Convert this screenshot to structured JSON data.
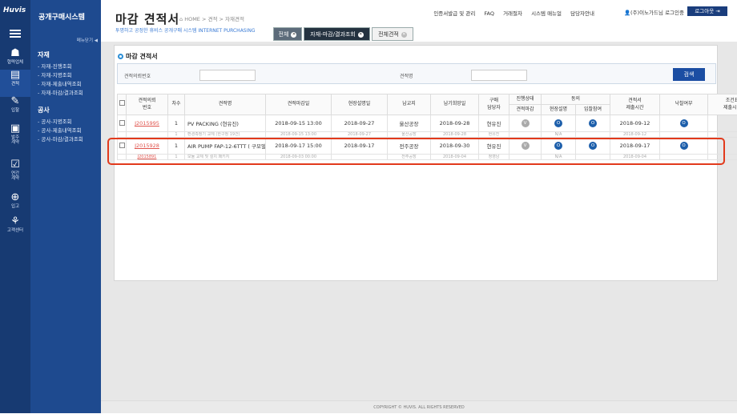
{
  "brand": {
    "logo": "Huvis",
    "system_title": "공개구매시스템"
  },
  "icon_nav": [
    {
      "label": "협력업체",
      "icon": "building-icon"
    },
    {
      "label": "견적",
      "icon": "clipboard-icon"
    },
    {
      "label": "입찰",
      "icon": "gavel-icon"
    },
    {
      "label": "발주\n계약",
      "icon": "document-icon"
    },
    {
      "label": "연간\n계약",
      "icon": "calendar-icon"
    },
    {
      "label": "입고",
      "icon": "globe-icon"
    },
    {
      "label": "고객센터",
      "icon": "plant-icon"
    }
  ],
  "sidebar": {
    "fold_label": "메뉴닫기 ◀",
    "sections": [
      {
        "title": "자재",
        "items": [
          "- 자재-진행조회",
          "- 자재-지명조회",
          "- 자재-제출내역조회",
          "- 자재-마감/결과조회"
        ]
      },
      {
        "title": "공사",
        "items": [
          "- 공사-지명조회",
          "- 공사-제출내역조회",
          "- 공사-마감/결과조회"
        ]
      }
    ]
  },
  "header": {
    "title": "마감 견적서",
    "breadcrumb": "⌂ HOME > 견적 > 자재견적",
    "subtitle": "투명하고 공정한 휴비스 공개구매 시스템 INTERNET PURCHASING",
    "links": [
      "인증서발급 및 관리",
      "FAQ",
      "거래절차",
      "시스템 매뉴얼",
      "담당자안내"
    ],
    "user": "(주)이노가드님 로그인중",
    "logout_label": "로그아웃 ⇥"
  },
  "tabs": [
    {
      "label": "전체",
      "style": "medium"
    },
    {
      "label": "자재-마감/결과조회",
      "style": "dark"
    },
    {
      "label": "전체견적",
      "style": "light"
    }
  ],
  "panel": {
    "title": "마감 견적서",
    "search": {
      "label1": "견적의뢰번호",
      "value1": "",
      "label2": "견적명",
      "value2": "",
      "button": "검색"
    }
  },
  "table": {
    "headers": {
      "no": "견적의뢰\n번호",
      "cnt": "차수",
      "name": "견적명",
      "deadline": "견적마감일",
      "site": "현장설명일",
      "place": "납교지",
      "delivery": "납기희망일",
      "owner": "구매\n담당자",
      "status": "진행상태",
      "status_sub": "견적마감",
      "agree": "동의",
      "agree1": "현장설명",
      "agree2": "입찰참여",
      "submit": "견적서\n제출시간",
      "award": "낙찰여부",
      "cond": "조건표\n제출시간"
    },
    "rows": [
      {
        "no": "J2015995",
        "cnt": "1",
        "name": "PV PACKING (현유진)",
        "deadline": "2018-09-15 13:00",
        "site": "2018-09-27",
        "place": "울산공장",
        "delivery": "2018-09-28",
        "owner": "현유진",
        "status": "V",
        "agree1": "O",
        "agree2": "O",
        "submit": "2018-09-12",
        "award": "O",
        "cond": ""
      },
      {
        "no": "",
        "cnt": "1",
        "name": "환경측정기 교체 (한구정 19건)",
        "deadline": "2018-09-15 13:00",
        "site": "2018-09-27",
        "place": "울산공장",
        "delivery": "2018-09-28",
        "owner": "현유진",
        "status": "",
        "agree1": "N/A",
        "agree2": "",
        "submit": "2018-09-12",
        "award": "",
        "cond": ""
      },
      {
        "no": "J2015928",
        "cnt": "1",
        "name": "AIR PUMP  FAP-12-6TTT ( 구모델/",
        "deadline": "2018-09-17 15:00",
        "site": "2018-09-17",
        "place": "전주공장",
        "delivery": "2018-09-30",
        "owner": "현유진",
        "status": "V",
        "agree1": "O",
        "agree2": "O",
        "submit": "2018-09-17",
        "award": "O",
        "cond": ""
      },
      {
        "no": "J2015891",
        "cnt": "1",
        "name": "모듈 교체 및 설치 패키지",
        "deadline": "2018-09-03 00:00",
        "site": "",
        "place": "전주공장",
        "delivery": "2018-09-04",
        "owner": "정영남",
        "status": "",
        "agree1": "N/A",
        "agree2": "",
        "submit": "2018-09-04",
        "award": "",
        "cond": ""
      }
    ]
  },
  "footer": "COPYRIGHT © HUVIS. ALL RIGHTS RESERVED",
  "colors": {
    "nav": "#173a72",
    "sidebar": "#1e4a8f",
    "accent": "#1b4ea3",
    "highlight": "#e23a1c",
    "link": "#e0544d"
  }
}
